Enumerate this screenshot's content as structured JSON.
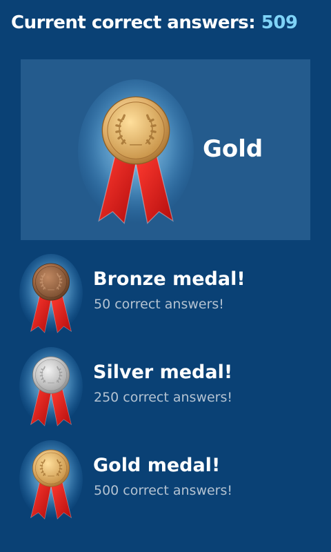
{
  "header": {
    "label": "Current correct answers: ",
    "count": "509"
  },
  "current_medal": {
    "label": "Gold",
    "icon": "gold-medal-icon",
    "color": "#d8ad66"
  },
  "medals": [
    {
      "title": "Bronze medal!",
      "subtitle": "50 correct answers!",
      "icon": "bronze-medal-icon",
      "color": "#a86f4c"
    },
    {
      "title": "Silver medal!",
      "subtitle": "250 correct answers!",
      "icon": "silver-medal-icon",
      "color": "#c9c9c9"
    },
    {
      "title": "Gold medal!",
      "subtitle": "500 correct answers!",
      "icon": "gold-medal-icon",
      "color": "#d8ad66"
    }
  ],
  "colors": {
    "background": "#0a4175",
    "card": "#245b8d",
    "accent": "#7fd3f7",
    "ribbon": "#e01a1a"
  }
}
